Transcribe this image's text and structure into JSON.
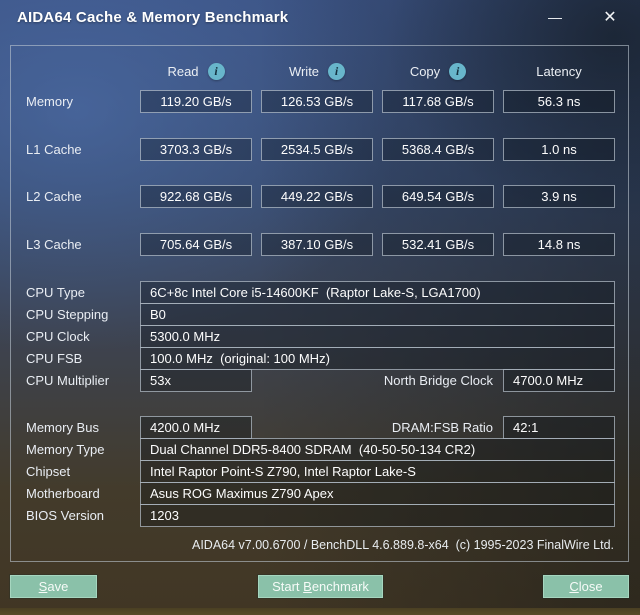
{
  "window": {
    "title": "AIDA64 Cache & Memory Benchmark",
    "controls": {
      "minimize_glyph": "—",
      "close_glyph": "✕"
    }
  },
  "benchmark_table": {
    "info_icon_glyph": "i",
    "columns": [
      {
        "label": "Read",
        "has_info": true
      },
      {
        "label": "Write",
        "has_info": true
      },
      {
        "label": "Copy",
        "has_info": true
      },
      {
        "label": "Latency",
        "has_info": false
      }
    ],
    "rows": [
      {
        "label": "Memory",
        "read": "119.20 GB/s",
        "write": "126.53 GB/s",
        "copy": "117.68 GB/s",
        "latency": "56.3 ns"
      },
      {
        "label": "L1 Cache",
        "read": "3703.3 GB/s",
        "write": "2534.5 GB/s",
        "copy": "5368.4 GB/s",
        "latency": "1.0 ns"
      },
      {
        "label": "L2 Cache",
        "read": "922.68 GB/s",
        "write": "449.22 GB/s",
        "copy": "649.54 GB/s",
        "latency": "3.9 ns"
      },
      {
        "label": "L3 Cache",
        "read": "705.64 GB/s",
        "write": "387.10 GB/s",
        "copy": "532.41 GB/s",
        "latency": "14.8 ns"
      }
    ]
  },
  "system_info": {
    "cpu_type": {
      "label": "CPU Type",
      "value": "6C+8c Intel Core i5-14600KF  (Raptor Lake-S, LGA1700)"
    },
    "cpu_stepping": {
      "label": "CPU Stepping",
      "value": "B0"
    },
    "cpu_clock": {
      "label": "CPU Clock",
      "value": "5300.0 MHz"
    },
    "cpu_fsb": {
      "label": "CPU FSB",
      "value": "100.0 MHz  (original: 100 MHz)"
    },
    "cpu_multiplier": {
      "label": "CPU Multiplier",
      "value": "53x"
    },
    "north_bridge_clock": {
      "label": "North Bridge Clock",
      "value": "4700.0 MHz"
    },
    "memory_bus": {
      "label": "Memory Bus",
      "value": "4200.0 MHz"
    },
    "dram_fsb_ratio": {
      "label": "DRAM:FSB Ratio",
      "value": "42:1"
    },
    "memory_type": {
      "label": "Memory Type",
      "value": "Dual Channel DDR5-8400 SDRAM  (40-50-50-134 CR2)"
    },
    "chipset": {
      "label": "Chipset",
      "value": "Intel Raptor Point-S Z790, Intel Raptor Lake-S"
    },
    "motherboard": {
      "label": "Motherboard",
      "value": "Asus ROG Maximus Z790 Apex"
    },
    "bios_version": {
      "label": "BIOS Version",
      "value": "1203"
    }
  },
  "footer": {
    "version_line": "AIDA64 v7.00.6700 / BenchDLL 4.6.889.8-x64  (c) 1995-2023 FinalWire Ltd."
  },
  "buttons": {
    "save": {
      "pre": "",
      "key": "S",
      "post": "ave"
    },
    "start_benchmark": {
      "pre": "Start ",
      "key": "B",
      "post": "enchmark"
    },
    "close": {
      "pre": "",
      "key": "C",
      "post": "lose"
    }
  },
  "colors": {
    "button_fill": "#8ac1a9",
    "info_icon_fill": "#68b6cb",
    "box_border": "#c4d0da",
    "background_top": "#3b5282",
    "background_bottom": "#413624"
  }
}
